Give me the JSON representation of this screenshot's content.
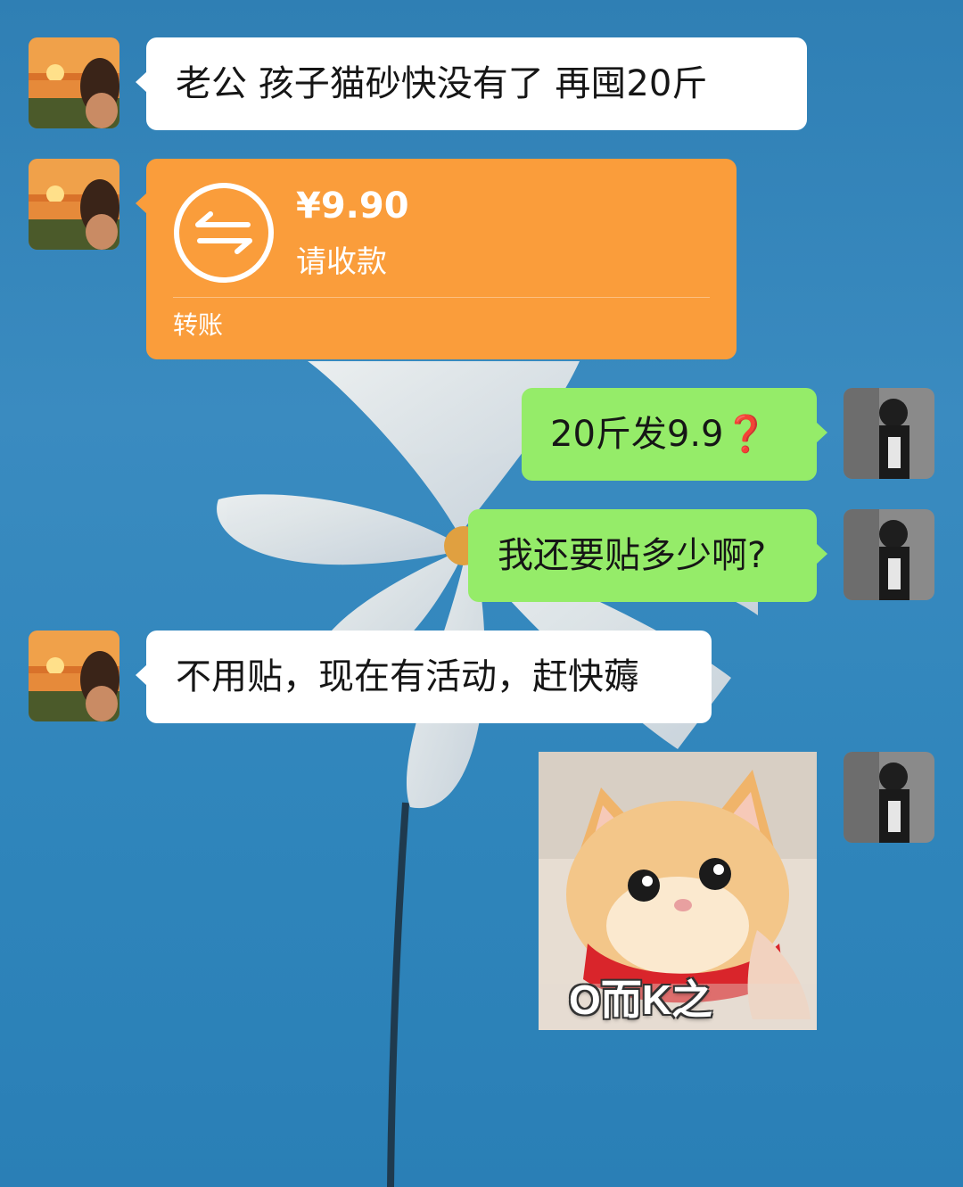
{
  "messages": [
    {
      "side": "left",
      "type": "text",
      "text": "老公 孩子猫砂快没有了 再囤20斤"
    },
    {
      "side": "left",
      "type": "transfer",
      "amount": "¥9.90",
      "status": "请收款",
      "kind": "转账"
    },
    {
      "side": "right",
      "type": "text",
      "text": "20斤发9.9",
      "emoji": "❓"
    },
    {
      "side": "right",
      "type": "text",
      "text": "我还要贴多少啊?"
    },
    {
      "side": "left",
      "type": "text",
      "text": "不用贴，现在有活动，赶快薅"
    },
    {
      "side": "right",
      "type": "sticker",
      "caption": "O而K之",
      "icon": "cat-sticker"
    }
  ],
  "colors": {
    "left_bubble": "#ffffff",
    "right_bubble": "#95ec69",
    "transfer_bubble": "#fa9d3b",
    "question_mark": "#e0241b"
  },
  "icons": {
    "transfer": "transfer-arrows-icon",
    "left_avatar": "sunset-girl-avatar",
    "right_avatar": "monochrome-boy-avatar"
  }
}
